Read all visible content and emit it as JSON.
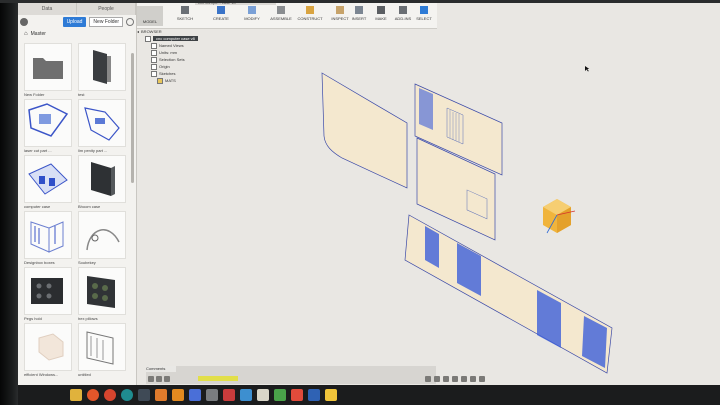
{
  "panel": {
    "tabs": [
      "Data",
      "People"
    ],
    "upload_label": "Upload",
    "newfolder_label": "New Folder",
    "crumb": "Master",
    "items": [
      {
        "label": "New Folder",
        "icon": "folder-icon"
      },
      {
        "label": "test",
        "icon": "pcb-thumb-icon"
      },
      {
        "label": "laser cut part ...",
        "icon": "assembly-thumb-icon"
      },
      {
        "label": "lim penity part ...",
        "icon": "assembly-thumb-icon"
      },
      {
        "label": "computer case",
        "icon": "blue-panel-thumb-icon"
      },
      {
        "label": "Bhoom case",
        "icon": "box-thumb-icon"
      },
      {
        "label": "Designbox boxes",
        "icon": "wire-thumb-icon"
      },
      {
        "label": "Soubekey",
        "icon": "curve-thumb-icon"
      },
      {
        "label": "Pegs hold",
        "icon": "pegboard-thumb-icon"
      },
      {
        "label": "hex pillows",
        "icon": "hex-thumb-icon"
      },
      {
        "label": "efficient Windows...",
        "icon": "ghost-thumb-icon"
      },
      {
        "label": "untitled",
        "icon": "frame-thumb-icon"
      }
    ]
  },
  "toolbar": {
    "workspace": "MODEL",
    "doc_tab": "cnc compu... case v8",
    "groups": [
      "SKETCH",
      "CREATE",
      "MODIFY",
      "ASSEMBLE",
      "CONSTRUCT",
      "INSPECT",
      "INSERT",
      "MAKE",
      "ADD-INS",
      "SELECT"
    ]
  },
  "browser": {
    "header": "BROWSER",
    "title": "cnc computer case v8",
    "rows": [
      "Named Views",
      "Units: mm",
      "Selection Sets",
      "Origin",
      "Sketches",
      "MATS"
    ]
  },
  "timeline": {
    "label": "Comments"
  },
  "colors": {
    "accent": "#2e7bd6",
    "panel_fill": "#f4e8cf",
    "panel_edge": "#3b4aa8",
    "hatch": "#3d5fd8"
  }
}
